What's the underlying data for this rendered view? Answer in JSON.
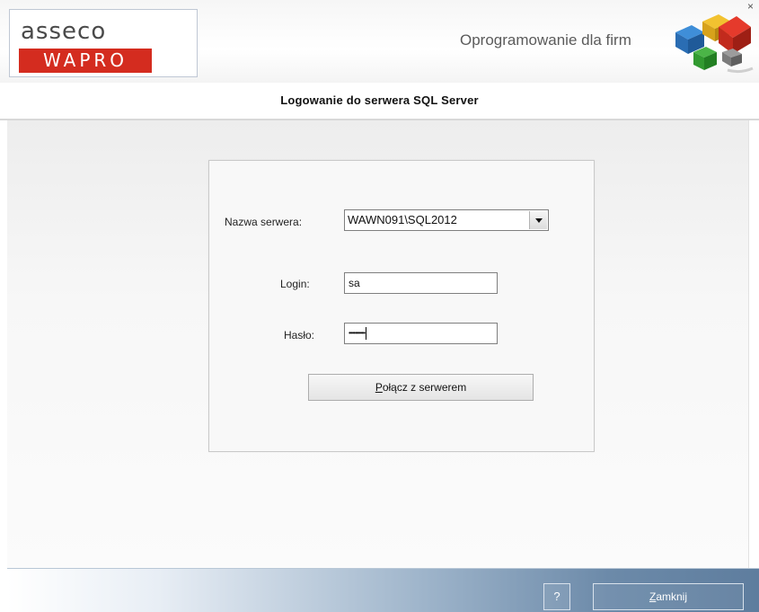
{
  "header": {
    "logo_top": "asseco",
    "logo_bottom": "WAPRO",
    "tagline": "Oprogramowanie dla firm",
    "close_glyph": "×",
    "colors": {
      "brand_red": "#d42c1f"
    },
    "icons": [
      "close-icon",
      "cubes-logo-icon"
    ]
  },
  "title": "Logowanie do serwera SQL Server",
  "form": {
    "server_label": "Nazwa serwera:",
    "server_value": "WAWN091\\SQL2012",
    "login_label": "Login:",
    "login_value": "sa",
    "password_label": "Hasło:",
    "password_value": "••••••••••",
    "connect_underlined": "P",
    "connect_rest": "ołącz z serwerem"
  },
  "footer": {
    "help_label": "?",
    "close_underlined": "Z",
    "close_rest": "amknij"
  }
}
